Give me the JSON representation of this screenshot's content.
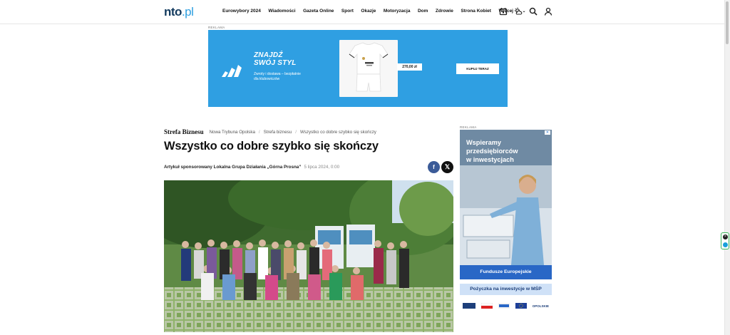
{
  "header": {
    "logo_main": "nto",
    "logo_suffix": ".pl",
    "nav": [
      "Eurowybory 2024",
      "Wiadomości",
      "Gazeta Online",
      "Sport",
      "Okazje",
      "Motoryzacja",
      "Dom",
      "Zdrowie",
      "Strona Kobiet",
      "Więcej"
    ],
    "icons": [
      "calendar-icon",
      "weather-icon",
      "search-icon",
      "user-icon"
    ]
  },
  "top_ad": {
    "label": "REKLAMA",
    "headline_line1": "ZNAJDŹ",
    "headline_line2": "SWÓJ STYL",
    "sub_line1": "Zwroty i dostawa – bezpłatnie",
    "sub_line2": "dla klubowiczów",
    "price": "270,00 zł",
    "cta": "KUPUJ TERAZ",
    "accent": "#2f9fe2"
  },
  "breadcrumb": {
    "brand": "Strefa Biznesu",
    "items": [
      "Nowa Trybuna Opolska",
      "Strefa biznesu",
      "Wszystko co dobre szybko się skończy"
    ]
  },
  "article": {
    "title": "Wszystko co dobre szybko się skończy",
    "meta_author": "Artykuł sponsorowany Lokalna Grupa Działania „Górna Prosna”",
    "meta_date": "5 lipca 2024, 0:00"
  },
  "share": {
    "facebook": "f",
    "x": "𝕏"
  },
  "side_ad": {
    "label": "REKLAMA",
    "close": "✕",
    "headline_line1": "Wspieramy",
    "headline_line2": "przedsiębiorców",
    "headline_line3": "w inwestycjach",
    "band1": "Fundusze Europejskie",
    "band2": "Pożyczka na inwestycje w MŚP",
    "footer_logo": "OPOLSKIE"
  }
}
